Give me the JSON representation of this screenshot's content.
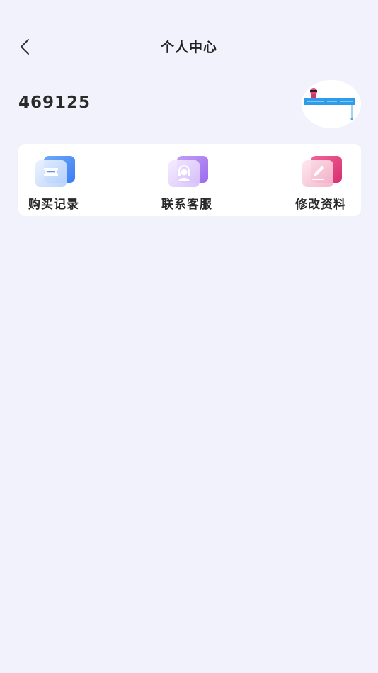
{
  "header": {
    "title": "个人中心",
    "back_icon": "chevron-left-icon"
  },
  "profile": {
    "user_id": "469125",
    "avatar_icon": "avatar-image"
  },
  "menu": {
    "items": [
      {
        "label": "购买记录",
        "icon": "ticket-icon",
        "color": "#4F8CF7"
      },
      {
        "label": "联系客服",
        "icon": "headset-icon",
        "color": "#A074F1"
      },
      {
        "label": "修改资料",
        "icon": "edit-icon",
        "color": "#E33C7C"
      }
    ]
  },
  "colors": {
    "background": "#F1F2FC",
    "card": "#FFFFFF"
  }
}
